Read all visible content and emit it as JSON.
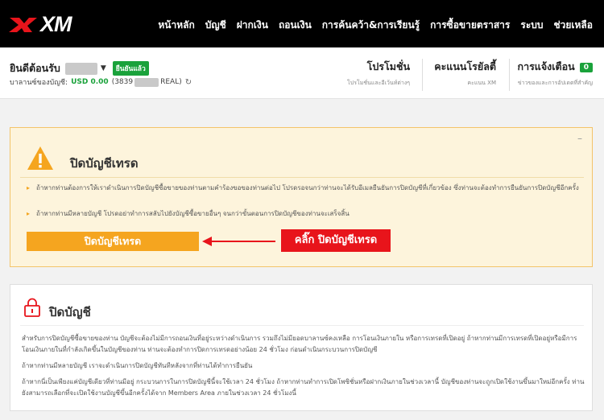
{
  "brand": {
    "logo_text": "XM",
    "accent": "#e8141b"
  },
  "nav": {
    "items": [
      "หน้าหลัก",
      "บัญชี",
      "ฝากเงิน",
      "ถอนเงิน",
      "การค้นคว้า&การเรียนรู้",
      "การซื้อขายตราสาร",
      "ระบบ",
      "ช่วยเหลือ"
    ]
  },
  "account": {
    "welcome": "ยินดีต้อนรับ",
    "verified_badge": "ยืนยันแล้ว",
    "balance_label": "บาลานซ์ของบัญชี:",
    "balance_value": "USD 0.00",
    "account_prefix": "(3839",
    "account_suffix": "REAL)"
  },
  "header_stats": {
    "promotions": {
      "title": "โปรโมชั่น",
      "subtitle": "โปรโมชั่นและอีเว้นท์ต่างๆ"
    },
    "loyalty": {
      "title": "คะแนนโรยัลตี้",
      "subtitle": "คะแนน XM"
    },
    "notifications": {
      "title": "การแจ้งเตือน",
      "count": "0",
      "subtitle": "ข่าวของและการอัปเดตที่สำคัญ"
    }
  },
  "warning_panel": {
    "title": "ปิดบัญชีเทรด",
    "minimize": "–",
    "bullet1": "ถ้าหากท่านต้องการให้เราดำเนินการปิดบัญชีซื้อขายของท่านตามคำร้องขอของท่านต่อไป โปรดรอจนกว่าท่านจะได้รับอีเมลยืนยันการปิดบัญชีที่เกี่ยวข้อง ซึ่งท่านจะต้องทำการยืนยันการปิดบัญชีอีกครั้ง",
    "bullet2": "ถ้าหากท่านมีหลายบัญชี โปรดอย่าทำการสลับไปยังบัญชีซื้อขายอื่นๆ จนกว่าขั้นตอนการปิดบัญชีของท่านจะเสร็จสิ้น",
    "button": "ปิดบัญชีเทรด",
    "callout": "คลิ๊ก ปิดบัญชีเทรด"
  },
  "info_panel": {
    "title": "ปิดบัญชี",
    "para1": "สำหรับการปิดบัญชีซื้อขายของท่าน บัญชีจะต้องไม่มีการถอนเงินที่อยู่ระหว่างดำเนินการ รวมถึงไม่มียอดบาลานซ์คงเหลือ การโอนเงินภายใน หรือการเทรดที่เปิดอยู่ ถ้าหากท่านมีการเทรดที่เปิดอยู่หรือมีการโอนเงินภายในที่กำลังเกิดขึ้นในบัญชีของท่าน ท่านจะต้องทำการปิดการเทรดอย่างน้อย 24 ชั่วโมง ก่อนดำเนินกระบวนการปิดบัญชี",
    "para2": "ถ้าหากท่านมีหลายบัญชี เราจะดำเนินการปิดบัญชีทันทีหลังจากที่ท่านได้ทำการยืนยัน",
    "para3": "ถ้าหากนี่เป็นเพียงแค่บัญชีเดียวที่ท่านมีอยู่ กระบวนการในการปิดบัญชีนี้จะใช้เวลา 24 ชั่วโมง ถ้าหากท่านทำการเปิดโพซิชั่นหรือฝากเงินภายในช่วงเวลานี้ บัญชีของท่านจะถูกเปิดใช้งานขึ้นมาใหม่อีกครั้ง ท่านยังสามารถเลือกที่จะเปิดใช้งานบัญชีขึ้นอีกครั้งได้จาก Members Area ภายในช่วงเวลา 24 ชั่วโมงนี้"
  }
}
